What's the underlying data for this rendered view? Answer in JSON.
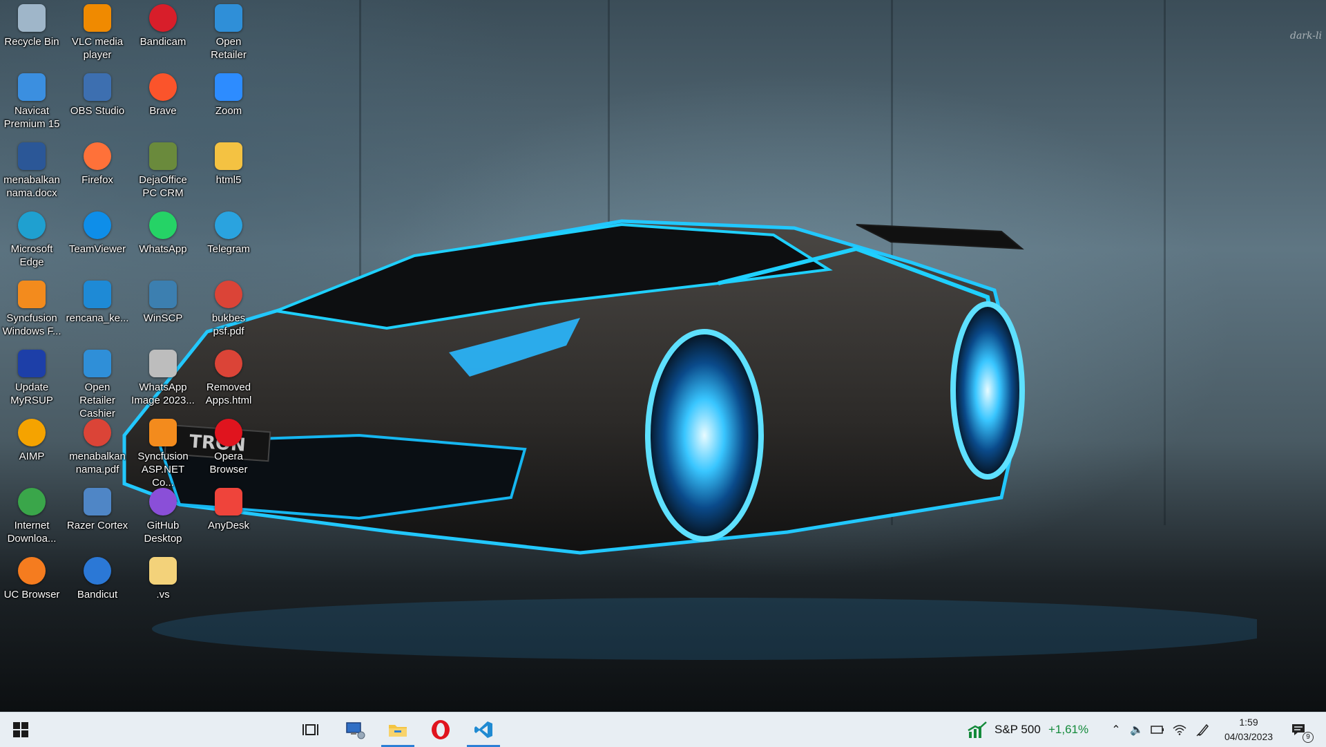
{
  "desktop_icons": [
    {
      "label": "Recycle Bin",
      "icon": "recycle-bin-icon",
      "color": "#9fb6c9"
    },
    {
      "label": "VLC media player",
      "icon": "vlc-icon",
      "color": "#f08a00"
    },
    {
      "label": "Bandicam",
      "icon": "bandicam-icon",
      "color": "#d81e2a"
    },
    {
      "label": "Open Retailer",
      "icon": "open-retailer-icon",
      "color": "#2f8fd8"
    },
    {
      "label": "Navicat Premium 15",
      "icon": "navicat-icon",
      "color": "#3b8fe0"
    },
    {
      "label": "OBS Studio",
      "icon": "obs-icon",
      "color": "#3d6fb0"
    },
    {
      "label": "Brave",
      "icon": "brave-icon",
      "color": "#fb542b"
    },
    {
      "label": "Zoom",
      "icon": "zoom-icon",
      "color": "#2d8cff"
    },
    {
      "label": "menabalkan nama.docx",
      "icon": "word-document-icon",
      "color": "#2b5797"
    },
    {
      "label": "Firefox",
      "icon": "firefox-icon",
      "color": "#ff7139"
    },
    {
      "label": "DejaOffice PC CRM",
      "icon": "dejaoffice-icon",
      "color": "#6a8a3c"
    },
    {
      "label": "html5",
      "icon": "html5-folder-icon",
      "color": "#f4c242"
    },
    {
      "label": "Microsoft Edge",
      "icon": "edge-icon",
      "color": "#1fa0d0"
    },
    {
      "label": "TeamViewer",
      "icon": "teamviewer-icon",
      "color": "#0e8ee9"
    },
    {
      "label": "WhatsApp",
      "icon": "whatsapp-icon",
      "color": "#25d366"
    },
    {
      "label": "Telegram",
      "icon": "telegram-icon",
      "color": "#2aa3df"
    },
    {
      "label": "Syncfusion Windows F...",
      "icon": "syncfusion-wf-icon",
      "color": "#f38b1d"
    },
    {
      "label": "rencana_ke...",
      "icon": "vscode-file-icon",
      "color": "#1e8ad6"
    },
    {
      "label": "WinSCP",
      "icon": "winscp-icon",
      "color": "#3c7fb0"
    },
    {
      "label": "bukbes psf.pdf",
      "icon": "chrome-pdf-icon",
      "color": "#db4437"
    },
    {
      "label": "Update MyRSUP",
      "icon": "myrsup-icon",
      "color": "#1d3fa8"
    },
    {
      "label": "Open Retailer Cashier",
      "icon": "open-retailer-cashier-icon",
      "color": "#2f8fd8"
    },
    {
      "label": "WhatsApp Image 2023...",
      "icon": "image-file-icon",
      "color": "#bdbdbd"
    },
    {
      "label": "Removed Apps.html",
      "icon": "chrome-html-icon",
      "color": "#db4437"
    },
    {
      "label": "AIMP",
      "icon": "aimp-icon",
      "color": "#f5a300"
    },
    {
      "label": "menabalkan nama.pdf",
      "icon": "chrome-pdf-icon",
      "color": "#db4437"
    },
    {
      "label": "Syncfusion ASP.NET Co...",
      "icon": "syncfusion-aspnet-icon",
      "color": "#f38b1d"
    },
    {
      "label": "Opera Browser",
      "icon": "opera-icon",
      "color": "#e0141e"
    },
    {
      "label": "Internet Downloa...",
      "icon": "idm-icon",
      "color": "#3aa64a"
    },
    {
      "label": "Razer Cortex",
      "icon": "razer-cortex-icon",
      "color": "#4f86c6"
    },
    {
      "label": "GitHub Desktop",
      "icon": "github-desktop-icon",
      "color": "#8a4fd8"
    },
    {
      "label": "AnyDesk",
      "icon": "anydesk-icon",
      "color": "#ef443b"
    },
    {
      "label": "UC Browser",
      "icon": "uc-browser-icon",
      "color": "#f57c1f"
    },
    {
      "label": "Bandicut",
      "icon": "bandicut-icon",
      "color": "#2b78d6"
    },
    {
      "label": ".vs",
      "icon": "folder-icon",
      "color": "#f3d27a"
    }
  ],
  "wallpaper": {
    "plate_text": "TRON",
    "watermark": "dark-li"
  },
  "taskbar": {
    "start": "windows-start-icon",
    "pinned": [
      {
        "name": "task-view",
        "icon": "task-view-icon",
        "active": false
      },
      {
        "name": "network-app",
        "icon": "network-computer-icon",
        "active": false
      },
      {
        "name": "file-explorer",
        "icon": "file-explorer-icon",
        "active": true
      },
      {
        "name": "opera",
        "icon": "opera-icon",
        "active": false
      },
      {
        "name": "vscode",
        "icon": "vscode-icon",
        "active": true
      }
    ],
    "widget": {
      "label": "S&P 500",
      "change": "+1,61%",
      "change_color": "#138a3a"
    },
    "tray": {
      "time": "1:59",
      "date": "04/03/2023",
      "notification_count": "9"
    }
  }
}
